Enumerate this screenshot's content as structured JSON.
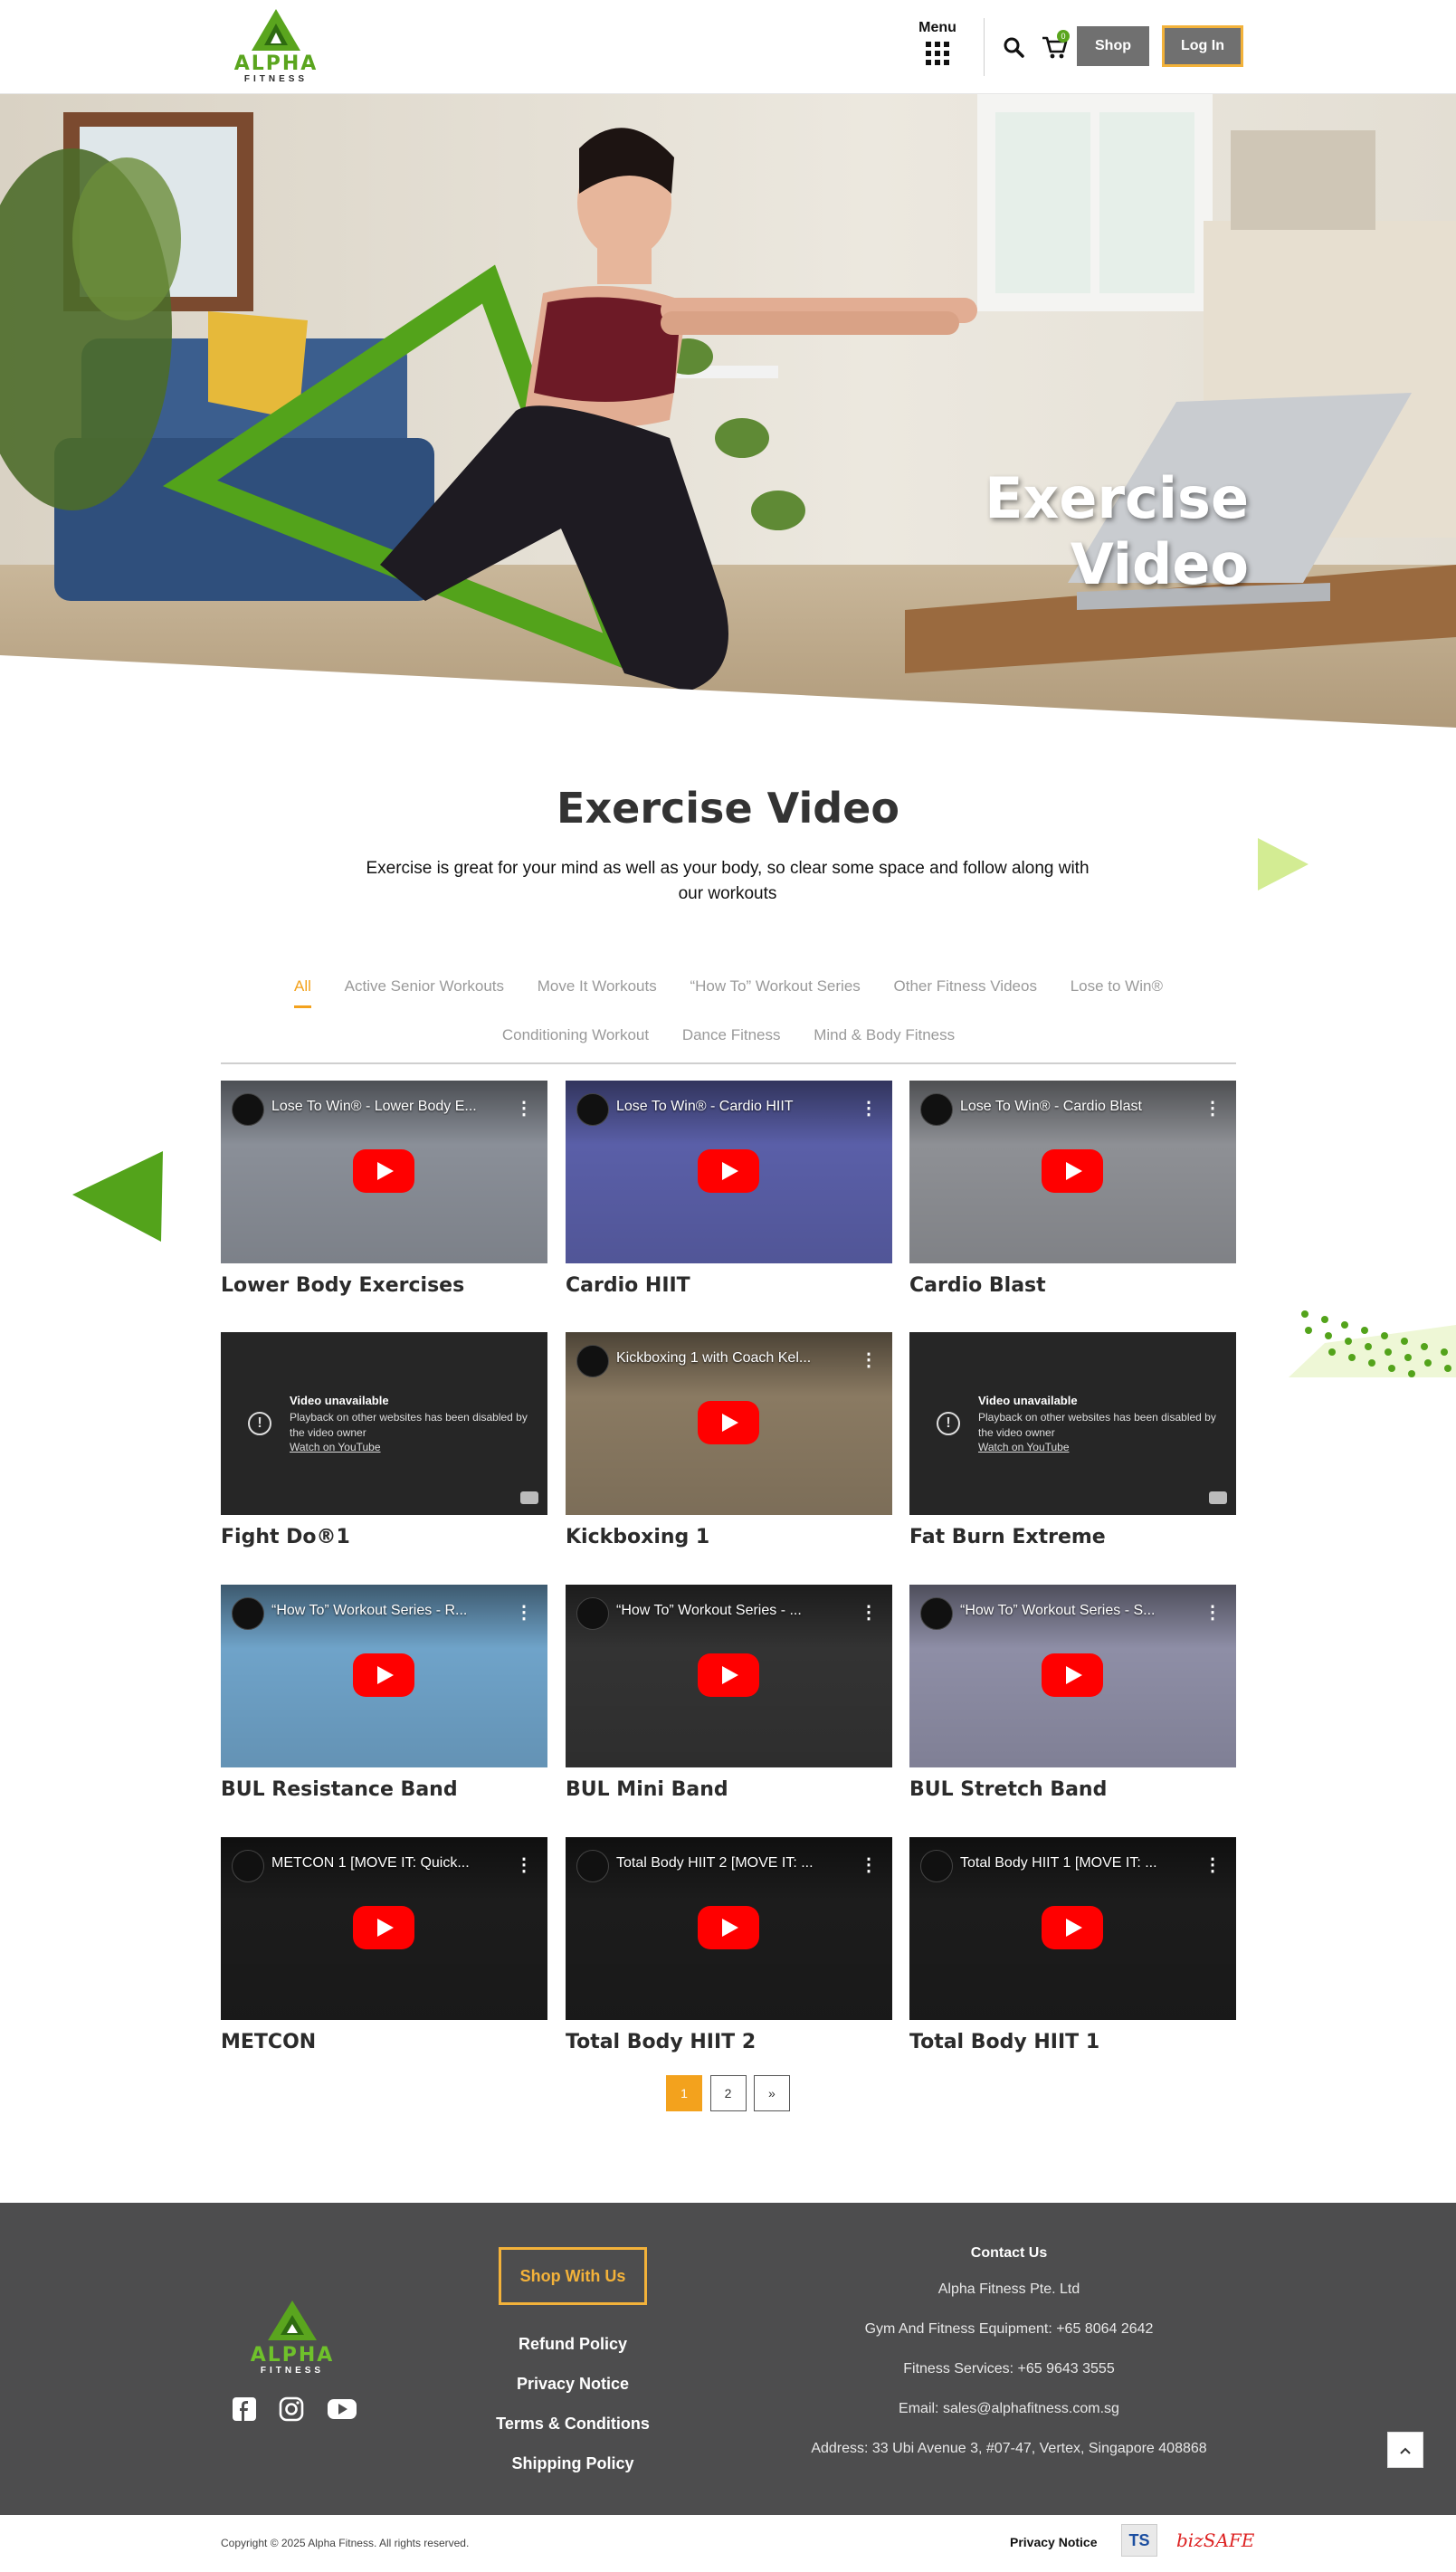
{
  "header": {
    "logo_text": "ALPHA",
    "logo_sub": "FITNESS",
    "menu_label": "Menu",
    "cart_count": "0",
    "shop_label": "Shop",
    "login_label": "Log In"
  },
  "hero": {
    "title": "Exercise Video"
  },
  "intro": {
    "title": "Exercise Video",
    "description": "Exercise is great for your mind as well as your body, so clear some space and follow along with our workouts"
  },
  "tabs": {
    "row1": [
      "All",
      "Active Senior Workouts",
      "Move It Workouts",
      "“How To” Workout Series",
      "Other Fitness Videos",
      "Lose to Win®"
    ],
    "row2": [
      "Conditioning Workout",
      "Dance Fitness",
      "Mind & Body Fitness"
    ],
    "active": "All"
  },
  "videos": [
    {
      "title": "Lower Body Exercises",
      "video_title": "Lose To Win® - Lower Body E...",
      "thumb": "#8a8f98",
      "available": true
    },
    {
      "title": "Cardio HIIT",
      "video_title": "Lose To Win® - Cardio HIIT",
      "thumb": "#5a5fa8",
      "available": true
    },
    {
      "title": "Cardio Blast",
      "video_title": "Lose To Win® - Cardio Blast",
      "thumb": "#8e9095",
      "available": true
    },
    {
      "title": "Fight Do®1",
      "available": false
    },
    {
      "title": "Kickboxing 1",
      "video_title": "Kickboxing 1 with Coach Kel...",
      "thumb": "#8a7a62",
      "available": true
    },
    {
      "title": "Fat Burn Extreme",
      "available": false
    },
    {
      "title": "BUL Resistance Band",
      "video_title": "“How To” Workout Series - R...",
      "thumb": "#6fa3c9",
      "available": true
    },
    {
      "title": "BUL Mini Band",
      "video_title": "“How To” Workout Series - ...",
      "thumb": "#333333",
      "available": true
    },
    {
      "title": "BUL Stretch Band",
      "video_title": "“How To” Workout Series - S...",
      "thumb": "#8e8ea6",
      "available": true
    },
    {
      "title": "METCON",
      "video_title": "METCON 1 [MOVE IT: Quick...",
      "thumb": "#1c1c1c",
      "available": true
    },
    {
      "title": "Total Body HIIT 2",
      "video_title": "Total Body HIIT 2 [MOVE IT: ...",
      "thumb": "#1c1c1c",
      "available": true
    },
    {
      "title": "Total Body HIIT 1",
      "video_title": "Total Body HIIT 1 [MOVE IT: ...",
      "thumb": "#1c1c1c",
      "available": true
    }
  ],
  "unavailable": {
    "heading": "Video unavailable",
    "message": "Playback on other websites has been disabled by the video owner",
    "link": "Watch on YouTube"
  },
  "pagination": {
    "pages": [
      "1",
      "2"
    ],
    "next": "»",
    "current": "1"
  },
  "footer": {
    "shop_with_us": "Shop With Us",
    "links": [
      "Refund Policy",
      "Privacy Notice",
      "Terms & Conditions",
      "Shipping Policy"
    ],
    "contact_heading": "Contact Us",
    "contact": [
      "Alpha Fitness Pte. Ltd",
      "Gym And Fitness Equipment: +65 8064 2642",
      "Fitness Services: +65 9643 3555",
      "Email: sales@alphafitness.com.sg",
      "Address: 33 Ubi Avenue 3, #07-47, Vertex, Singapore 408868"
    ],
    "social": [
      "facebook-icon",
      "instagram-icon",
      "youtube-icon"
    ]
  },
  "bottom": {
    "copyright": "Copyright © 2025 Alpha Fitness. All rights reserved.",
    "privacy": "Privacy Notice",
    "ts_badge": "TS",
    "bizsafe": "bizSAFE"
  },
  "colors": {
    "brand_green": "#5aa51e",
    "accent_orange": "#f3a21d",
    "footer_bg": "#4d4d4e"
  }
}
